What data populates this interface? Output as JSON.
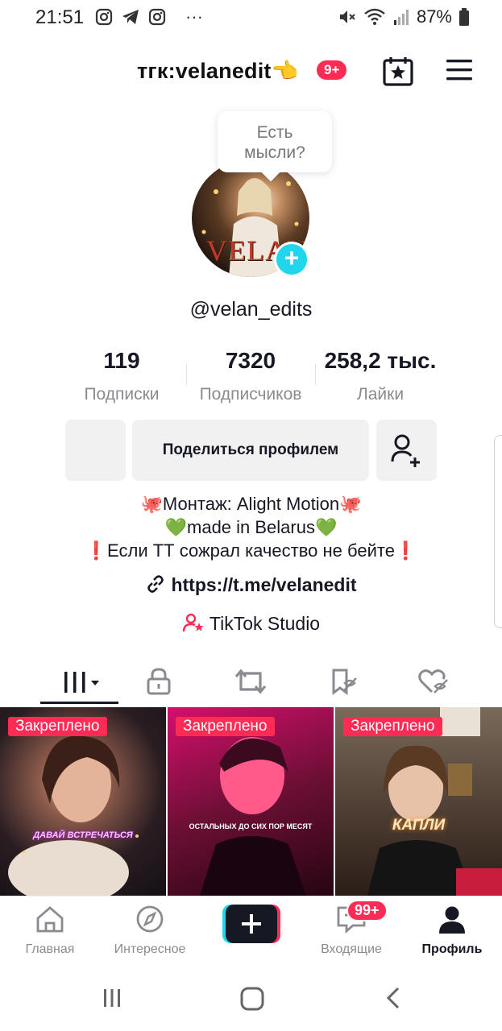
{
  "status_bar": {
    "time": "21:51",
    "left_icons": [
      "instagram-icon",
      "telegram-icon",
      "instagram-icon",
      "more-icon"
    ],
    "more": "···",
    "right_icons": [
      "mute-icon",
      "wifi-icon",
      "signal-icon",
      "battery-icon"
    ],
    "battery": "87%"
  },
  "header": {
    "title": "тгк:velanedit👈",
    "badge": "9+"
  },
  "bubble": {
    "line1": "Есть",
    "line2": "мысли?"
  },
  "profile": {
    "avatar_text": "VELAN",
    "username": "@velan_edits"
  },
  "stats": [
    {
      "value": "119",
      "label": "Подписки"
    },
    {
      "value": "7320",
      "label": "Подписчиков"
    },
    {
      "value": "258,2 тыс.",
      "label": "Лайки"
    }
  ],
  "actions": {
    "share_label": "Поделиться профилем"
  },
  "bio": {
    "line1": "🐙Монтаж: Alight Motion🐙",
    "line2": "💚made in Belarus💚",
    "line3": "❗Если ТТ сожрал качество не бейте❗",
    "link": "https://t.me/velanedit",
    "studio": "TikTok Studio"
  },
  "tabs": [
    "videos-grid-icon",
    "lock-icon",
    "repost-icon",
    "favorites-icon",
    "liked-icon"
  ],
  "videos": [
    {
      "pin": "Закреплено",
      "caption": "ДАВАЙ ВСТРЕЧАТЬСЯ",
      "bg": "#3a2a2c"
    },
    {
      "pin": "Закреплено",
      "caption": "ОСТАЛЬНЫХ ДО СИХ ПОР МЕСЯТ",
      "bg": "#a0154d"
    },
    {
      "pin": "Закреплено",
      "caption": "КАПЛИ",
      "bg": "#4a3a30"
    }
  ],
  "bottom_nav": {
    "home": "Главная",
    "discover": "Интересное",
    "inbox": "Входящие",
    "inbox_badge": "99+",
    "profile": "Профиль"
  },
  "colors": {
    "accent_red": "#fe2c55",
    "accent_cyan": "#20d5ec",
    "text_primary": "#161823",
    "text_secondary": "#8a8b91"
  }
}
